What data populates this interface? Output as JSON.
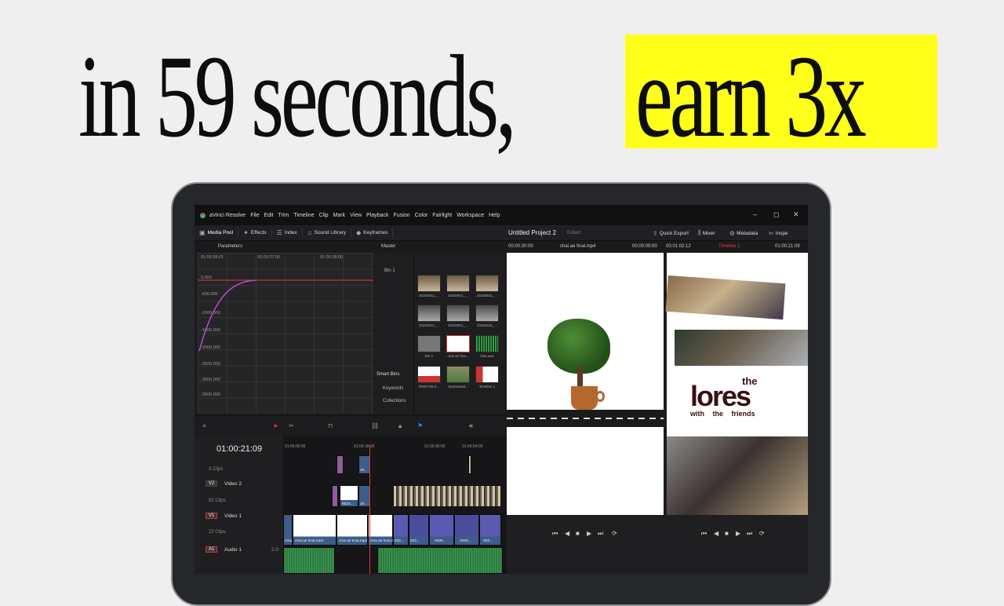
{
  "headline": {
    "left": "in 59 seconds,",
    "highlighted": "earn 3x"
  },
  "menubar": {
    "app_title": "aVinci Resolve",
    "items": [
      "File",
      "Edit",
      "Trim",
      "Timeline",
      "Clip",
      "Mark",
      "View",
      "Playback",
      "Fusion",
      "Color",
      "Fairlight",
      "Workspace",
      "Help"
    ],
    "minimize": "–",
    "restore": "◻",
    "close": "✕"
  },
  "toolbar": {
    "media_pool": "Media Pool",
    "effects": "Effects",
    "index": "Index",
    "sound_library": "Sound Library",
    "keyframes": "Keyframes",
    "project_title": "Untitled Project 2",
    "project_state": "Edited",
    "quick_export": "Quick Export",
    "mixer": "Mixer",
    "metadata": "Metadata",
    "inspector": "Inspe"
  },
  "subbar": {
    "parameters": "Parameters",
    "master": "Master",
    "source_tc": "00:00:30:00",
    "source_clip": "chai ae final.mp4",
    "tc_a": "00:00:09:00",
    "tc_b": "00:01:02:12",
    "timeline_name": "Timeline 1",
    "record_tc": "01:00:21:09"
  },
  "curve_editor": {
    "ticks": [
      "01:00:36:01",
      "01:00:37:00",
      "01:00:38:00"
    ],
    "values": [
      "0.000",
      "-500.000",
      "-1000.000",
      "-1500.000",
      "-2000.000",
      "-2500.000",
      "-3000.000",
      "-3500.000"
    ]
  },
  "bins": {
    "bin1": "Bin 1",
    "smart_bins": "Smart Bins",
    "keywords": "Keywords",
    "collections": "Collections"
  },
  "media_pool": {
    "thumbs": [
      "20250911_...",
      "20250911_...",
      "20250911_...",
      "20250911_...",
      "20250911_...",
      "20250911_...",
      "Bin 1",
      "chai ae fina...",
      "chai.wav",
      "f3930725-b...",
      "SpotDownl...",
      "Timeline 1"
    ]
  },
  "viewer_text": {
    "the": "the",
    "lores": "lores",
    "sub": "with the friends"
  },
  "timeline": {
    "timecode": "01:00:21:09",
    "ruler": [
      "01:00:00:00",
      "01:00:18:00",
      "01:00:36:00",
      "01:00:54:00"
    ],
    "tracks": [
      {
        "tag": "",
        "name": "",
        "clips": "3 Clips"
      },
      {
        "tag": "V2",
        "name": "Video 2",
        "clips": "82 Clips"
      },
      {
        "tag": "V1",
        "name": "Video 1",
        "clips": "22 Clips"
      },
      {
        "tag": "A1",
        "name": "Audio 1",
        "clips": "2.0"
      }
    ],
    "clip_labels": [
      "20..",
      "20..",
      "6833...",
      "20..",
      "chai..",
      "chai ae final.mp4",
      "chai ae final.mp4",
      "chai ae final.mp4",
      "202...",
      "202...",
      "2025...",
      "2025...",
      "202..."
    ]
  },
  "colors": {
    "highlight": "#ffff1a",
    "accent_red": "#e33333",
    "clip_blue": "#3c5d89",
    "audio_green": "#275b34"
  }
}
